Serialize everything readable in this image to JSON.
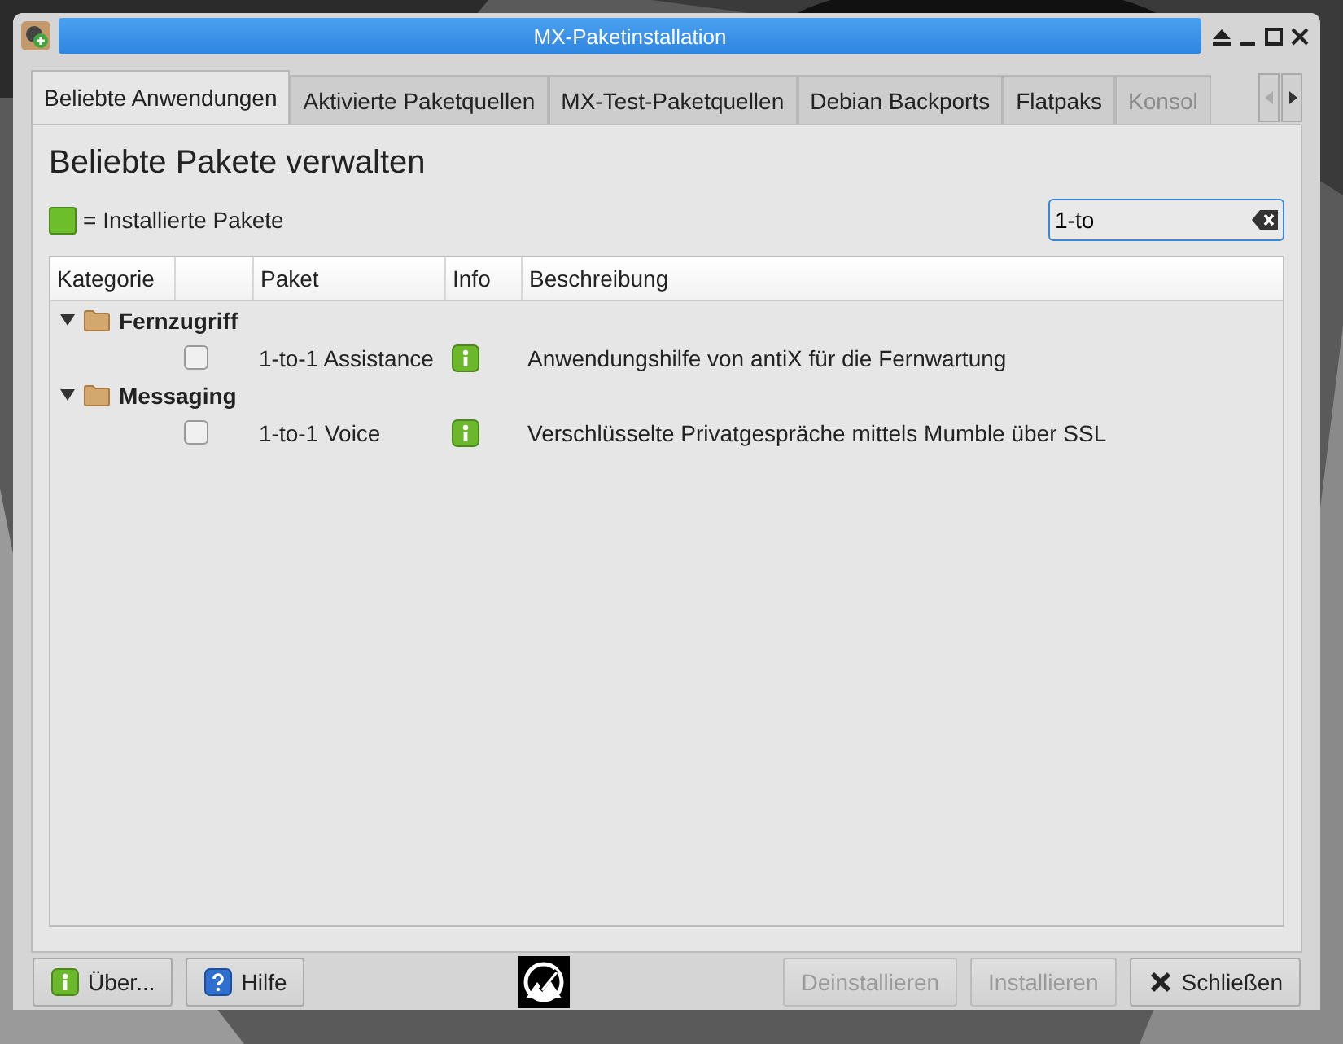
{
  "window": {
    "title": "MX-Paketinstallation"
  },
  "tabs": [
    {
      "label": "Beliebte Anwendungen",
      "selected": true,
      "disabled": false
    },
    {
      "label": "Aktivierte Paketquellen",
      "selected": false,
      "disabled": false
    },
    {
      "label": "MX-Test-Paketquellen",
      "selected": false,
      "disabled": false
    },
    {
      "label": "Debian Backports",
      "selected": false,
      "disabled": false
    },
    {
      "label": "Flatpaks",
      "selected": false,
      "disabled": false
    },
    {
      "label": "Konsol",
      "selected": false,
      "disabled": true
    }
  ],
  "heading": "Beliebte Pakete verwalten",
  "legend": {
    "color": "#6cbf2a",
    "label": "= Installierte Pakete"
  },
  "search": {
    "value": "1-to"
  },
  "table": {
    "columns": [
      "Kategorie",
      "Paket",
      "Info",
      "Beschreibung"
    ],
    "groups": [
      {
        "category": "Fernzugriff",
        "expanded": true,
        "children": [
          {
            "name": "1-to-1 Assistance",
            "checked": false,
            "description": "Anwendungshilfe von antiX für die Fernwartung"
          }
        ]
      },
      {
        "category": "Messaging",
        "expanded": true,
        "children": [
          {
            "name": "1-to-1 Voice",
            "checked": false,
            "description": "Verschlüsselte Privatgespräche mittels Mumble über SSL"
          }
        ]
      }
    ]
  },
  "buttons": [
    {
      "kind": "info",
      "label": "Über...",
      "disabled": false
    },
    {
      "kind": "help",
      "label": "Hilfe",
      "disabled": false
    },
    {
      "kind": "logo"
    },
    {
      "kind": "plain",
      "label": "Deinstallieren",
      "disabled": true
    },
    {
      "kind": "plain",
      "label": "Installieren",
      "disabled": true
    },
    {
      "kind": "close",
      "label": "Schließen",
      "disabled": false
    }
  ]
}
